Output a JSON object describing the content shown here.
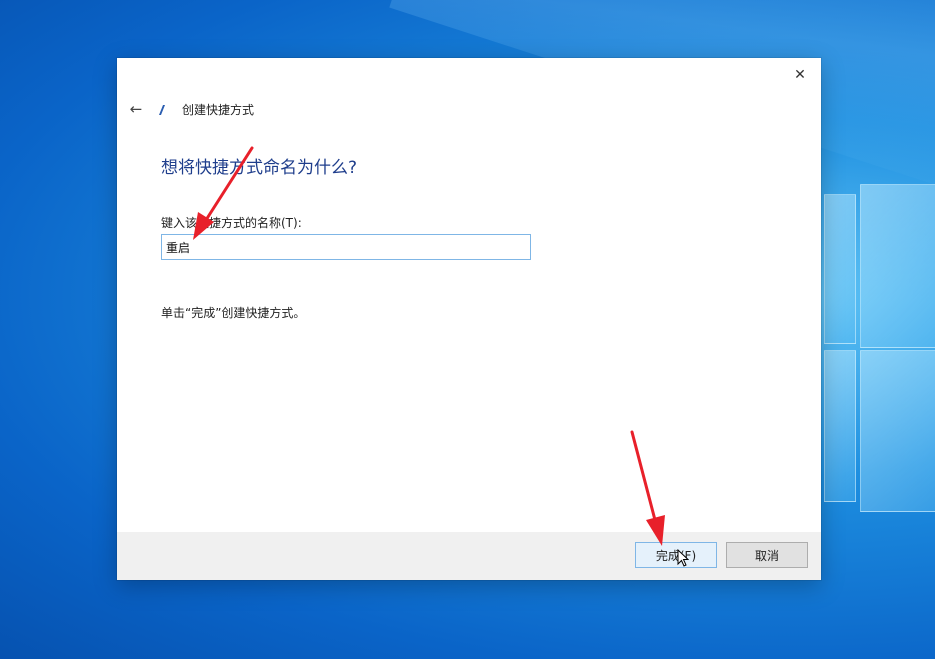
{
  "dialog": {
    "header_title": "创建快捷方式",
    "heading": "想将快捷方式命名为什么?",
    "field_label": "键入该快捷方式的名称(T):",
    "name_value": "重启",
    "instruction": "单击“完成”创建快捷方式。",
    "close_glyph": "✕",
    "back_glyph": "←"
  },
  "footer": {
    "finish_label": "完成(F)",
    "cancel_label": "取消"
  },
  "colors": {
    "heading": "#1f3e8c",
    "annotation_arrow": "#e8202a",
    "focus_border": "#7fb6e6"
  },
  "icons": {
    "close": "close-icon",
    "back": "back-arrow-icon",
    "shortcut": "shortcut-icon",
    "cursor": "mouse-cursor-icon"
  }
}
